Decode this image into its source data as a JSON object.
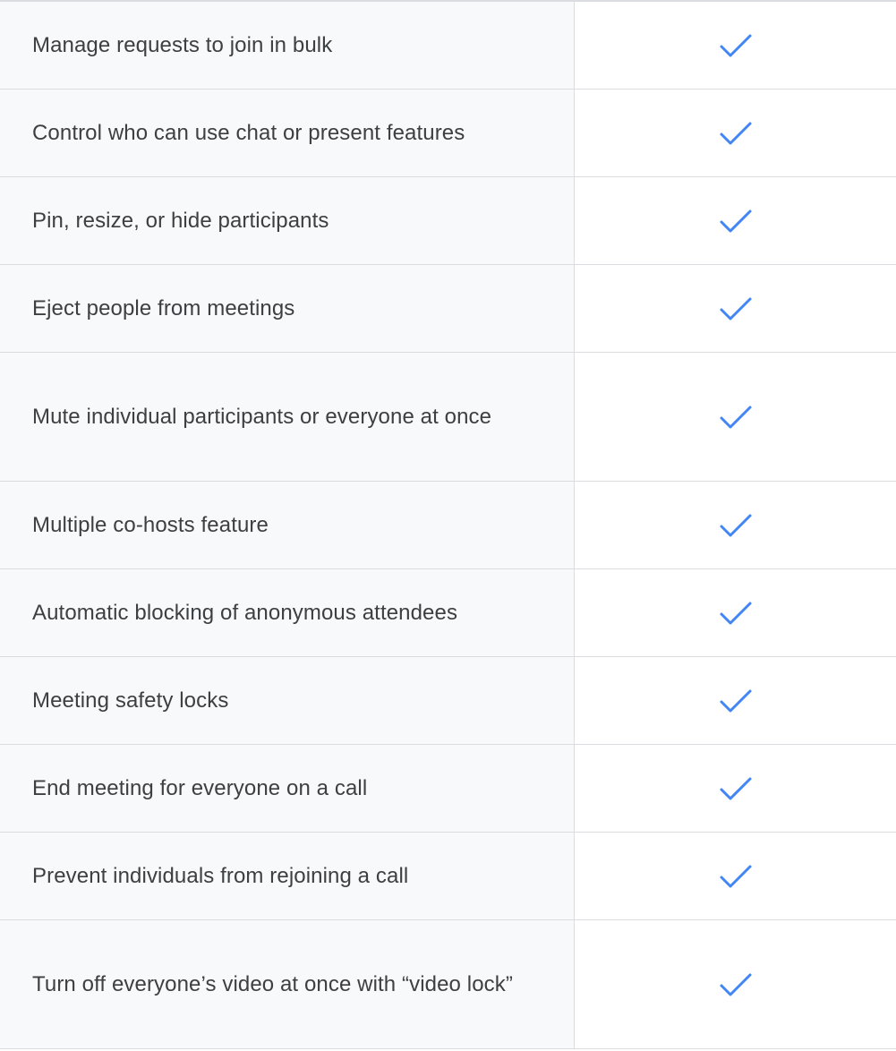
{
  "table": {
    "check_color": "#4285f4",
    "rows": [
      {
        "feature": "Manage requests to join in bulk",
        "icon": "check-icon",
        "lines": 1
      },
      {
        "feature": "Control who can use chat or present features",
        "icon": "check-icon",
        "lines": 1
      },
      {
        "feature": "Pin, resize, or hide participants",
        "icon": "check-icon",
        "lines": 1
      },
      {
        "feature": "Eject people from meetings",
        "icon": "check-icon",
        "lines": 1
      },
      {
        "feature": "Mute individual participants or everyone at once",
        "icon": "check-icon",
        "lines": 2
      },
      {
        "feature": "Multiple co-hosts feature",
        "icon": "check-icon",
        "lines": 1
      },
      {
        "feature": "Automatic blocking of anonymous attendees",
        "icon": "check-icon",
        "lines": 1
      },
      {
        "feature": "Meeting safety locks",
        "icon": "check-icon",
        "lines": 1
      },
      {
        "feature": "End meeting for everyone on a call",
        "icon": "check-icon",
        "lines": 1
      },
      {
        "feature": "Prevent individuals from rejoining a call",
        "icon": "check-icon",
        "lines": 1
      },
      {
        "feature": "Turn off everyone’s video at once with “video lock”",
        "icon": "check-icon",
        "lines": 2
      }
    ]
  }
}
